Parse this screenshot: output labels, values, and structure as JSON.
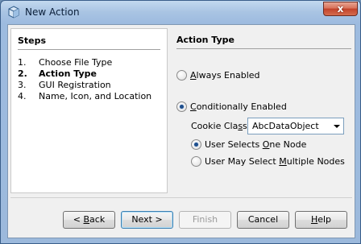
{
  "window": {
    "title": "New Action",
    "close_glyph": "x"
  },
  "steps": {
    "heading": "Steps",
    "items": [
      {
        "num": "1.",
        "label": "Choose File Type",
        "current": false
      },
      {
        "num": "2.",
        "label": "Action Type",
        "current": true
      },
      {
        "num": "3.",
        "label": "GUI Registration",
        "current": false
      },
      {
        "num": "4.",
        "label": "Name, Icon, and Location",
        "current": false
      }
    ]
  },
  "content": {
    "heading": "Action Type",
    "always_enabled": {
      "pre": "",
      "mnemonic": "A",
      "post": "lways Enabled",
      "checked": false
    },
    "conditionally_enabled": {
      "pre": "",
      "mnemonic": "C",
      "post": "onditionally Enabled",
      "checked": true
    },
    "cookie_class": {
      "pre": "Cookie Cla",
      "mnemonic": "s",
      "post": "s:",
      "value": "AbcDataObject"
    },
    "user_selects_one": {
      "pre": "User Selects ",
      "mnemonic": "O",
      "post": "ne Node",
      "checked": true
    },
    "user_selects_multiple": {
      "pre": "User May Select ",
      "mnemonic": "M",
      "post": "ultiple Nodes",
      "checked": false
    }
  },
  "buttons": {
    "back": {
      "pre": "< ",
      "mnemonic": "B",
      "post": "ack"
    },
    "next": "Next >",
    "finish": "Finish",
    "cancel": "Cancel",
    "help": {
      "pre": "",
      "mnemonic": "H",
      "post": "elp"
    }
  },
  "colors": {
    "title_gradient_top": "#c3d9ef",
    "close_red": "#c2422a",
    "radio_dot": "#1f4f8c"
  }
}
